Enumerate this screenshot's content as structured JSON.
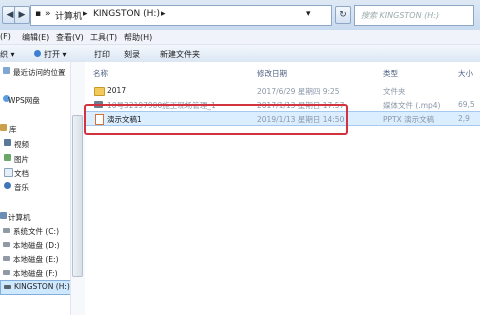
{
  "address": {
    "back_glyph": "◀",
    "forward_glyph": "▶",
    "crumbs": [
      "▪",
      "»",
      "计算机",
      "▸",
      "KINGSTON (H:)",
      "▸"
    ],
    "dropdown_glyph": "▾",
    "refresh_glyph": "↻",
    "search_placeholder": "搜索 KINGSTON (H:)"
  },
  "menu": [
    "(F)",
    "编辑(E)",
    "查看(V)",
    "工具(T)",
    "帮助(H)"
  ],
  "toolbar": {
    "organize": "织 ▾",
    "open": "打开 ▾",
    "print": "打印",
    "burn": "刻录",
    "new_folder": "新建文件夹"
  },
  "sidebar": [
    {
      "label": "最近访问的位置",
      "icon": "recent-places-icon"
    },
    {
      "label": "WPS网盘",
      "icon": "cloud-drive-icon"
    },
    {
      "label": "库",
      "icon": "library-icon"
    },
    {
      "label": "视频",
      "icon": "video-icon"
    },
    {
      "label": "图片",
      "icon": "picture-icon"
    },
    {
      "label": "文档",
      "icon": "document-icon"
    },
    {
      "label": "音乐",
      "icon": "music-icon"
    },
    {
      "label": "计算机",
      "icon": "computer-icon"
    },
    {
      "label": "系统文件 (C:)",
      "icon": "drive-icon"
    },
    {
      "label": "本地磁盘 (D:)",
      "icon": "drive-icon"
    },
    {
      "label": "本地磁盘 (E:)",
      "icon": "drive-icon"
    },
    {
      "label": "本地磁盘 (F:)",
      "icon": "drive-icon"
    },
    {
      "label": "KINGSTON (H:)",
      "icon": "usb-drive-icon"
    }
  ],
  "columns": [
    "名称",
    "修改日期",
    "类型",
    "大小"
  ],
  "files": [
    {
      "name": "2017",
      "date": "2017/6/29 星期四 9:25",
      "type": "文件夹",
      "size": "",
      "icon": "folder-icon"
    },
    {
      "name": "10号32197900施工现场管理_1",
      "date": "2017/1/13 星期日 17:57",
      "type": "媒体文件 (.mp4)",
      "size": "69,5",
      "icon": "video-file-icon"
    },
    {
      "name": "演示文稿1",
      "date": "2019/1/13 星期日 14:50",
      "type": "PPTX 演示文稿",
      "size": "2,9",
      "icon": "pptx-file-icon"
    }
  ],
  "colors": {
    "selection": "#dbeeff",
    "highlight_border": "#d1333f",
    "column_header": "#4d6082"
  }
}
